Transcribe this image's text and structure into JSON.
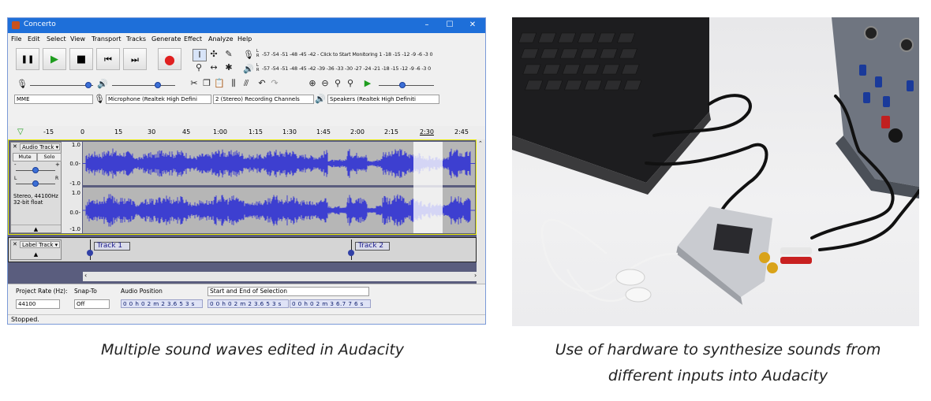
{
  "window": {
    "title": "Concerto",
    "controls": [
      "–",
      "☐",
      "✕"
    ]
  },
  "menu": [
    "File",
    "Edit",
    "Select",
    "View",
    "Transport",
    "Tracks",
    "Generate",
    "Effect",
    "Analyze",
    "Help"
  ],
  "transport": [
    {
      "name": "pause-button",
      "glyph": "❚❚",
      "color": "#000000"
    },
    {
      "name": "play-button",
      "glyph": "▶",
      "color": "#1f9d1f"
    },
    {
      "name": "stop-button",
      "glyph": "■",
      "color": "#111111"
    },
    {
      "name": "skip-start-button",
      "glyph": "⏮",
      "color": "#111111"
    },
    {
      "name": "skip-end-button",
      "glyph": "⏭",
      "color": "#111111"
    },
    {
      "name": "record-button",
      "glyph": "●",
      "color": "#e02020"
    }
  ],
  "meters": {
    "record_scale": "-57 -54 -51 -48 -45 -42 -",
    "record_prompt": "Click to Start Monitoring",
    "record_tail": "1 -18 -15 -12  -9  -6  -3  0",
    "play_scale": "-57 -54 -51 -48 -45 -42 -39 -36 -33 -30 -27 -24 -21 -18 -15 -12  -9  -6  -3  0",
    "lr": [
      "L",
      "R"
    ]
  },
  "devices": {
    "host": "MME",
    "input": "Microphone (Realtek High Defini",
    "channels": "2 (Stereo) Recording Channels",
    "output": "Speakers (Realtek High Definiti"
  },
  "ruler": [
    "-15",
    "0",
    "15",
    "30",
    "45",
    "1:00",
    "1:15",
    "1:30",
    "1:45",
    "2:00",
    "2:15",
    "2:30",
    "2:45"
  ],
  "audio_track": {
    "name": "Audio Track",
    "mute": "Mute",
    "solo": "Solo",
    "gain_marks": [
      "-",
      "+"
    ],
    "pan_marks": [
      "L",
      "R"
    ],
    "info": "Stereo, 44100Hz\n32-bit float",
    "scale": [
      "1.0",
      "0.0-",
      "-1.0",
      "1.0",
      "0.0-",
      "-1.0"
    ]
  },
  "label_track": {
    "name": "Label Track",
    "labels": [
      "Track 1",
      "Track 2"
    ]
  },
  "bottom": {
    "project_rate_label": "Project Rate (Hz):",
    "project_rate": "44100",
    "snap_to_label": "Snap-To",
    "snap_to": "Off",
    "audio_position_label": "Audio Position",
    "audio_position": "0 0 h 0 2 m 2 3.6 5 3 s",
    "selection_label": "Start and End of Selection",
    "selection_start": "0 0 h 0 2 m 2 3.6 5 3 s",
    "selection_end": "0 0 h 0 2 m 3 6.7 7 6 s"
  },
  "status": "Stopped.",
  "colors": {
    "titlebar": "#1e6fd9",
    "waveform": "#3d3fd0",
    "track_bg": "#5a5d7e"
  },
  "captions": {
    "left": "Multiple sound waves edited in Audacity",
    "right_line1": "Use of hardware to synthesize sounds from",
    "right_line2": "different inputs into Audacity"
  }
}
